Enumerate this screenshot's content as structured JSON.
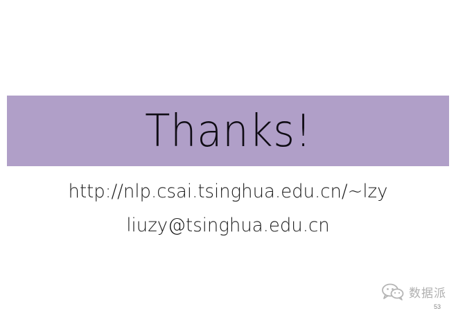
{
  "slide": {
    "title": "Thanks!",
    "contact_url": "http://nlp.csai.tsinghua.edu.cn/~lzy",
    "contact_email": "liuzy@tsinghua.edu.cn",
    "page_number": "53"
  },
  "watermark": {
    "text": "数据派",
    "icon": "wechat-icon"
  },
  "colors": {
    "title_band": "#b09fc8",
    "title_text": "#0f0c14",
    "body_text": "#1a1a1a",
    "watermark": "#b0b0b0"
  }
}
